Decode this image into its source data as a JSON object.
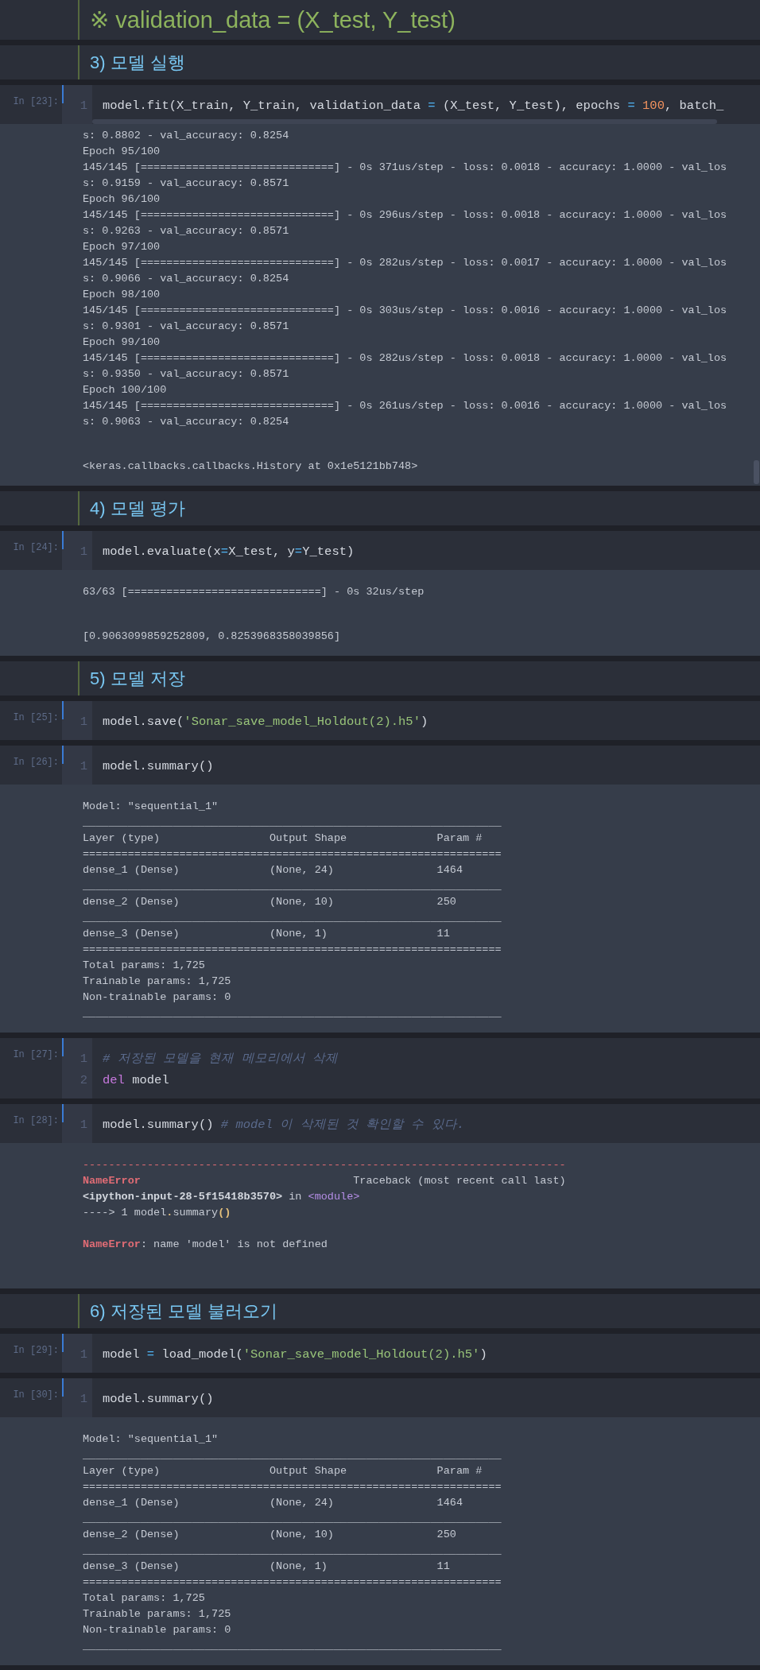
{
  "cells": [
    {
      "kind": "title",
      "text": "※ validation_data = (X_test, Y_test)"
    },
    {
      "kind": "heading",
      "text": "3) 모델 실행"
    },
    {
      "kind": "code",
      "prompt": "In [23]:",
      "scrollbars": true,
      "lines": [
        {
          "number": "1",
          "tokens": [
            {
              "text": "model.fit(X_train, Y_train, validation_data "
            },
            {
              "text": "=",
              "kind": "op"
            },
            {
              "text": " (X_test, Y_test), epochs "
            },
            {
              "text": "= ",
              "kind": "op"
            },
            {
              "text": "100",
              "kind": "num"
            },
            {
              "text": ", batch_"
            }
          ]
        }
      ],
      "outputs": [
        {
          "kind": "stream",
          "lines": [
            [
              {
                "text": "s: 0.8802 - val_accuracy: 0.8254"
              }
            ],
            [
              {
                "text": "Epoch 95/100"
              }
            ],
            [
              {
                "text": "145/145 [==============================] - 0s 371us/step - loss: 0.0018 - accuracy: 1.0000 - val_los"
              }
            ],
            [
              {
                "text": "s: 0.9159 - val_accuracy: 0.8571"
              }
            ],
            [
              {
                "text": "Epoch 96/100"
              }
            ],
            [
              {
                "text": "145/145 [==============================] - 0s 296us/step - loss: 0.0018 - accuracy: 1.0000 - val_los"
              }
            ],
            [
              {
                "text": "s: 0.9263 - val_accuracy: 0.8571"
              }
            ],
            [
              {
                "text": "Epoch 97/100"
              }
            ],
            [
              {
                "text": "145/145 [==============================] - 0s 282us/step - loss: 0.0017 - accuracy: 1.0000 - val_los"
              }
            ],
            [
              {
                "text": "s: 0.9066 - val_accuracy: 0.8254"
              }
            ],
            [
              {
                "text": "Epoch 98/100"
              }
            ],
            [
              {
                "text": "145/145 [==============================] - 0s 303us/step - loss: 0.0016 - accuracy: 1.0000 - val_los"
              }
            ],
            [
              {
                "text": "s: 0.9301 - val_accuracy: 0.8571"
              }
            ],
            [
              {
                "text": "Epoch 99/100"
              }
            ],
            [
              {
                "text": "145/145 [==============================] - 0s 282us/step - loss: 0.0018 - accuracy: 1.0000 - val_los"
              }
            ],
            [
              {
                "text": "s: 0.9350 - val_accuracy: 0.8571"
              }
            ],
            [
              {
                "text": "Epoch 100/100"
              }
            ],
            [
              {
                "text": "145/145 [==============================] - 0s 261us/step - loss: 0.0016 - accuracy: 1.0000 - val_los"
              }
            ],
            [
              {
                "text": "s: 0.9063 - val_accuracy: 0.8254"
              }
            ]
          ]
        },
        {
          "kind": "result",
          "lines": [
            [
              {
                "text": "<keras.callbacks.callbacks.History at 0x1e5121bb748>"
              }
            ]
          ]
        }
      ]
    },
    {
      "kind": "heading",
      "text": "4) 모델 평가"
    },
    {
      "kind": "code",
      "prompt": "In [24]:",
      "scrollbars": false,
      "lines": [
        {
          "number": "1",
          "tokens": [
            {
              "text": "model.evaluate(x"
            },
            {
              "text": "=",
              "kind": "op"
            },
            {
              "text": "X_test, y"
            },
            {
              "text": "=",
              "kind": "op"
            },
            {
              "text": "Y_test)"
            }
          ]
        }
      ],
      "outputs": [
        {
          "kind": "stream",
          "lines": [
            [
              {
                "text": "63/63 [==============================] - 0s 32us/step"
              }
            ]
          ]
        },
        {
          "kind": "result",
          "lines": [
            [
              {
                "text": "[0.9063099859252809, 0.8253968358039856]"
              }
            ]
          ]
        }
      ]
    },
    {
      "kind": "heading",
      "text": "5) 모델 저장"
    },
    {
      "kind": "code",
      "prompt": "In [25]:",
      "scrollbars": false,
      "lines": [
        {
          "number": "1",
          "tokens": [
            {
              "text": "model.save("
            },
            {
              "text": "'Sonar_save_model_Holdout(2).h5'",
              "kind": "str"
            },
            {
              "text": ")"
            }
          ]
        }
      ]
    },
    {
      "kind": "code",
      "prompt": "In [26]:",
      "scrollbars": false,
      "lines": [
        {
          "number": "1",
          "tokens": [
            {
              "text": "model.summary()"
            }
          ]
        }
      ],
      "outputs": [
        {
          "kind": "stream",
          "lines": [
            [
              {
                "text": "Model: \"sequential_1\""
              }
            ],
            [
              {
                "text": "_________________________________________________________________"
              }
            ],
            [
              {
                "text": "Layer (type)                 Output Shape              Param #"
              }
            ],
            [
              {
                "text": "================================================================="
              }
            ],
            [
              {
                "text": "dense_1 (Dense)              (None, 24)                1464"
              }
            ],
            [
              {
                "text": "_________________________________________________________________"
              }
            ],
            [
              {
                "text": "dense_2 (Dense)              (None, 10)                250"
              }
            ],
            [
              {
                "text": "_________________________________________________________________"
              }
            ],
            [
              {
                "text": "dense_3 (Dense)              (None, 1)                 11"
              }
            ],
            [
              {
                "text": "================================================================="
              }
            ],
            [
              {
                "text": "Total params: 1,725"
              }
            ],
            [
              {
                "text": "Trainable params: 1,725"
              }
            ],
            [
              {
                "text": "Non-trainable params: 0"
              }
            ],
            [
              {
                "text": "_________________________________________________________________"
              }
            ]
          ]
        }
      ]
    },
    {
      "kind": "code",
      "prompt": "In [27]:",
      "scrollbars": false,
      "lines": [
        {
          "number": "1",
          "tokens": [
            {
              "text": "# 저장된 모델을 현재 메모리에서 삭제",
              "kind": "com"
            }
          ]
        },
        {
          "number": "2",
          "tokens": [
            {
              "text": "del",
              "kind": "kw"
            },
            {
              "text": " model"
            }
          ]
        }
      ]
    },
    {
      "kind": "code",
      "prompt": "In [28]:",
      "scrollbars": false,
      "lines": [
        {
          "number": "1",
          "tokens": [
            {
              "text": "model.summary() "
            },
            {
              "text": "# model 이 삭제된 것 확인할 수 있다.",
              "kind": "com"
            }
          ]
        }
      ],
      "outputs": [
        {
          "kind": "error",
          "lines": [
            [
              {
                "text": "---------------------------------------------------------------------------",
                "kind": "red"
              }
            ],
            [
              {
                "text": "NameError",
                "kind": "err"
              },
              {
                "text": "                                 Traceback (most recent call last)"
              }
            ],
            [
              {
                "text": "<ipython-input-28-5f15418b3570>",
                "kind": "bold"
              },
              {
                "text": " in "
              },
              {
                "text": "<module>",
                "kind": "module"
              }
            ],
            [
              {
                "text": "----> 1 model"
              },
              {
                "text": ".",
                "kind": "paren"
              },
              {
                "text": "summary"
              },
              {
                "text": "()",
                "kind": "paren"
              }
            ]
          ]
        },
        {
          "kind": "error",
          "lines": [
            [
              {
                "text": "NameError",
                "kind": "err"
              },
              {
                "text": ": name 'model' is not defined"
              }
            ]
          ]
        }
      ]
    },
    {
      "kind": "heading",
      "text": "6) 저장된 모델 불러오기"
    },
    {
      "kind": "code",
      "prompt": "In [29]:",
      "scrollbars": false,
      "lines": [
        {
          "number": "1",
          "tokens": [
            {
              "text": "model "
            },
            {
              "text": "=",
              "kind": "op"
            },
            {
              "text": " load_model("
            },
            {
              "text": "'Sonar_save_model_Holdout(2).h5'",
              "kind": "str"
            },
            {
              "text": ")"
            }
          ]
        }
      ]
    },
    {
      "kind": "code",
      "prompt": "In [30]:",
      "scrollbars": false,
      "lines": [
        {
          "number": "1",
          "tokens": [
            {
              "text": "model.summary()"
            }
          ]
        }
      ],
      "outputs": [
        {
          "kind": "stream",
          "lines": [
            [
              {
                "text": "Model: \"sequential_1\""
              }
            ],
            [
              {
                "text": "_________________________________________________________________"
              }
            ],
            [
              {
                "text": "Layer (type)                 Output Shape              Param #"
              }
            ],
            [
              {
                "text": "================================================================="
              }
            ],
            [
              {
                "text": "dense_1 (Dense)              (None, 24)                1464"
              }
            ],
            [
              {
                "text": "_________________________________________________________________"
              }
            ],
            [
              {
                "text": "dense_2 (Dense)              (None, 10)                250"
              }
            ],
            [
              {
                "text": "_________________________________________________________________"
              }
            ],
            [
              {
                "text": "dense_3 (Dense)              (None, 1)                 11"
              }
            ],
            [
              {
                "text": "================================================================="
              }
            ],
            [
              {
                "text": "Total params: 1,725"
              }
            ],
            [
              {
                "text": "Trainable params: 1,725"
              }
            ],
            [
              {
                "text": "Non-trainable params: 0"
              }
            ],
            [
              {
                "text": "_________________________________________________________________"
              }
            ]
          ]
        }
      ]
    }
  ]
}
